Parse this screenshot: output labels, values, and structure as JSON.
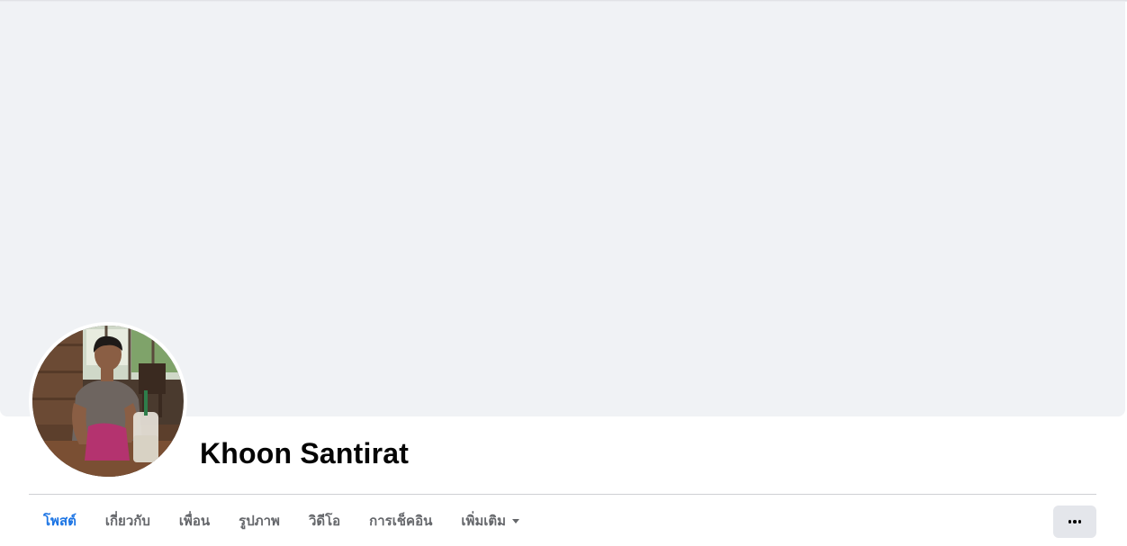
{
  "profile": {
    "name": "Khoon Santirat",
    "avatar_icon": "profile-photo"
  },
  "tabs": [
    {
      "label": "โพสต์",
      "active": true
    },
    {
      "label": "เกี่ยวกับ",
      "active": false
    },
    {
      "label": "เพื่อน",
      "active": false
    },
    {
      "label": "รูปภาพ",
      "active": false
    },
    {
      "label": "วิดีโอ",
      "active": false
    },
    {
      "label": "การเช็คอิน",
      "active": false
    },
    {
      "label": "เพิ่มเติม",
      "active": false,
      "dropdown": true
    }
  ],
  "actions": {
    "more_icon": "more-options-icon"
  },
  "colors": {
    "accent": "#1b74e4",
    "cover": "#f0f2f5",
    "tab_text": "#65676b",
    "button_bg": "#e4e6eb"
  }
}
